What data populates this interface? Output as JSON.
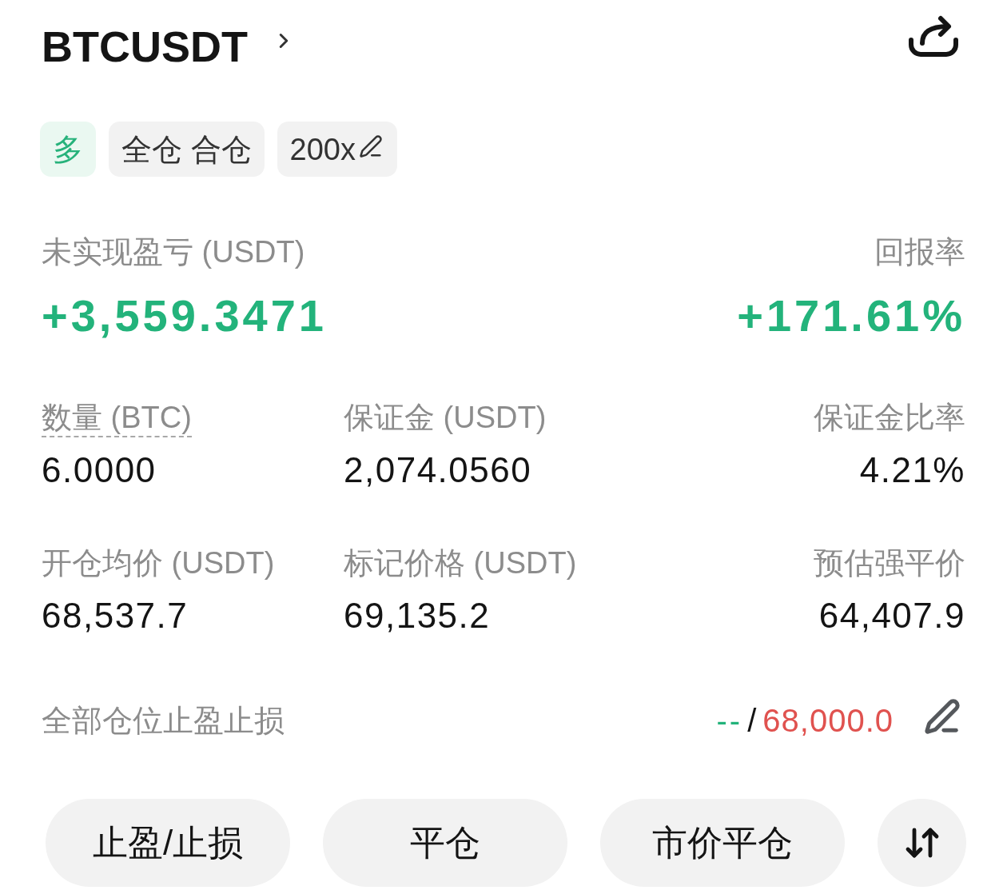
{
  "header": {
    "symbol": "BTCUSDT"
  },
  "tags": [
    {
      "kind": "side",
      "label": "多"
    },
    {
      "kind": "plain",
      "label": "全仓 合仓"
    },
    {
      "kind": "editable",
      "label": "200x"
    }
  ],
  "summary": [
    {
      "label": "未实现盈亏 (USDT)",
      "value": "+3,559.3471"
    },
    {
      "label": "回报率",
      "value": "+171.61%"
    }
  ],
  "stats": [
    {
      "label": "数量 (BTC)",
      "value": "6.0000",
      "underlined": true
    },
    {
      "label": "保证金 (USDT)",
      "value": "2,074.0560",
      "underlined": false
    },
    {
      "label": "保证金比率",
      "value": "4.21%",
      "underlined": false
    },
    {
      "label": "开仓均价 (USDT)",
      "value": "68,537.7",
      "underlined": false
    },
    {
      "label": "标记价格 (USDT)",
      "value": "69,135.2",
      "underlined": false
    },
    {
      "label": "预估强平价",
      "value": "64,407.9",
      "underlined": false
    }
  ],
  "tp_sl": {
    "label": "全部仓位止盈止损",
    "take_profit": "--",
    "separator": "/",
    "stop_loss": "68,000.0"
  },
  "actions": [
    {
      "kind": "text",
      "label": "止盈/止损"
    },
    {
      "kind": "text",
      "label": "平仓"
    },
    {
      "kind": "text",
      "label": "市价平仓"
    },
    {
      "kind": "icon"
    }
  ]
}
